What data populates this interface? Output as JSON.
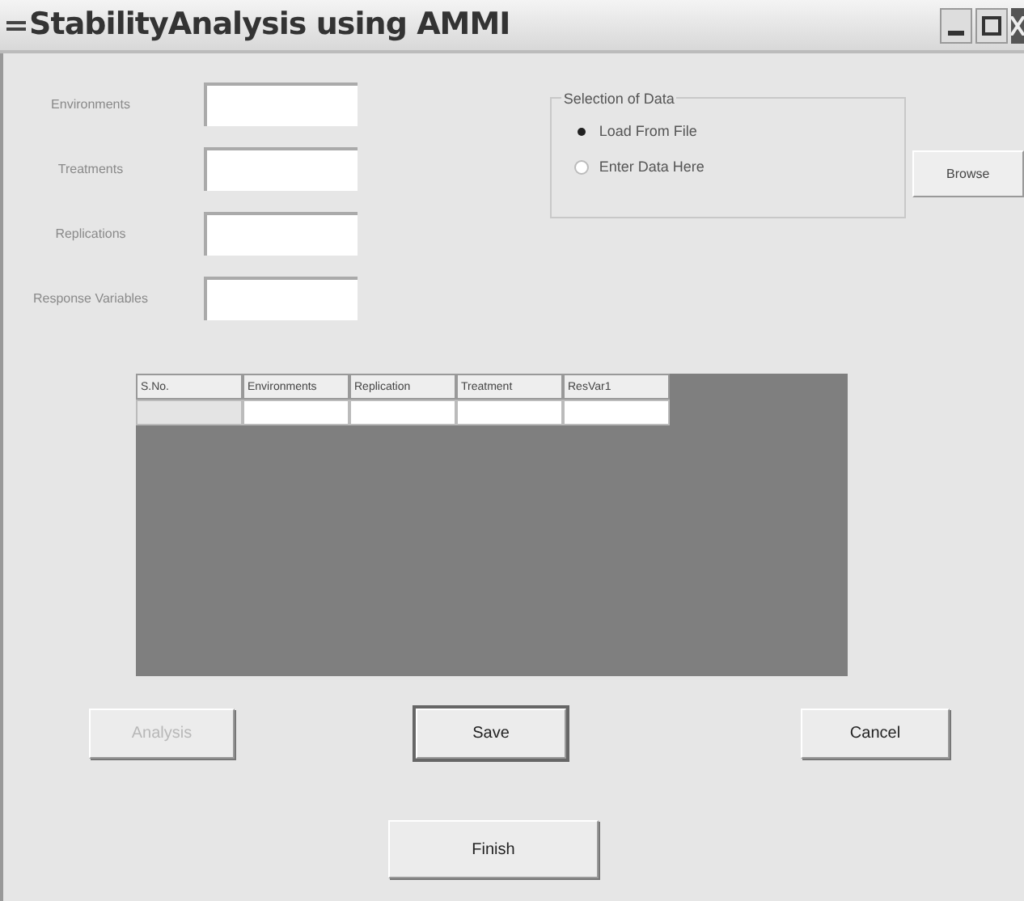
{
  "window": {
    "title": "StabilityAnalysis using AMMI"
  },
  "fields": [
    {
      "label": "Environments"
    },
    {
      "label": "Treatments"
    },
    {
      "label": "Replications"
    },
    {
      "label": "Response Variables"
    }
  ],
  "data_selection": {
    "title": "Selection of Data",
    "options": [
      {
        "label": "Load From File",
        "selected": true
      },
      {
        "label": "Enter Data Here",
        "selected": false
      }
    ]
  },
  "browse_button": "Browse",
  "table": {
    "columns": [
      "S.No.",
      "Environments",
      "Replication",
      "Treatment",
      "ResVar1"
    ]
  },
  "buttons": [
    {
      "label": "Analysis",
      "disabled": true,
      "default": false
    },
    {
      "label": "Save",
      "disabled": false,
      "default": true
    },
    {
      "label": "Cancel",
      "disabled": false,
      "default": false
    }
  ],
  "finish_button": {
    "label": "Finish",
    "disabled": false
  }
}
